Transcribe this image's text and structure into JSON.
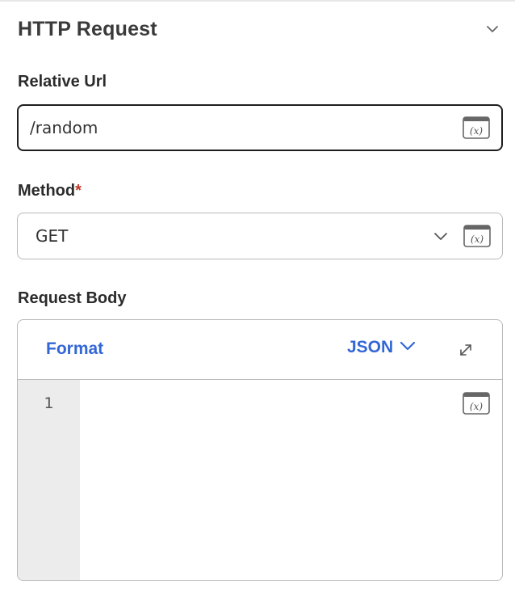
{
  "section": {
    "title": "HTTP Request",
    "collapse_icon": "chevron-down-icon"
  },
  "relative_url": {
    "label": "Relative Url",
    "value": "/random",
    "variable_icon": "variable-x-icon"
  },
  "method": {
    "label": "Method",
    "required_mark": "*",
    "value": "GET",
    "dropdown_icon": "chevron-down-icon",
    "variable_icon": "variable-x-icon"
  },
  "request_body": {
    "label": "Request Body",
    "format_label": "Format",
    "format_value": "JSON",
    "format_dropdown_icon": "chevron-down-icon",
    "expand_icon": "expand-arrows-icon",
    "variable_icon": "variable-x-icon",
    "line_numbers": [
      "1"
    ],
    "content": ""
  },
  "colors": {
    "accent": "#3367d6",
    "required": "#c0392b",
    "border": "#b9b9b9",
    "focus_border": "#1e1e1e",
    "gutter": "#ececec"
  }
}
